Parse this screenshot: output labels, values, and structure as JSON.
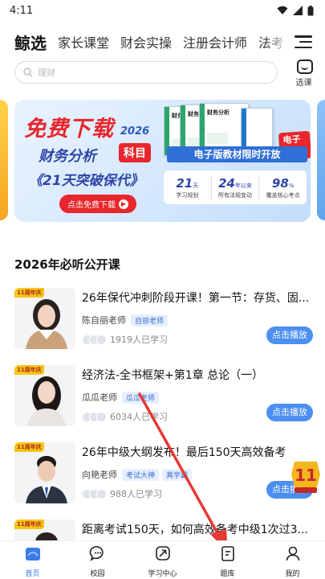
{
  "status": {
    "time": "4:11"
  },
  "top_tabs": [
    "鲸选",
    "家长课堂",
    "财会实操",
    "注册会计师",
    "法考"
  ],
  "search": {
    "placeholder": "理财"
  },
  "course_select_label": "选课",
  "banner": {
    "title": "免费下载",
    "year": "2026",
    "subject": "财务分析",
    "subject_badge": "科目",
    "subtitle": "《21天突破保代》",
    "cta": "点击免费下载",
    "book_label": "财务分析",
    "ebook_tag": "电子版",
    "ebook_line": "电子版教材限时开放",
    "stats": [
      {
        "num": "21",
        "unit": "天",
        "desc": "学习规划"
      },
      {
        "num": "24",
        "unit": "年以来",
        "desc": "所有法规变动"
      },
      {
        "num": "98",
        "unit": "%",
        "desc": "覆盖核心考点"
      }
    ]
  },
  "section_title": "2026年必听公开课",
  "courses": [
    {
      "ribbon": "11周年庆",
      "title": "26年保代冲刺阶段开课！第一节：存货、固...",
      "teacher": "陈自丽老师",
      "tags": [
        "自丽老师"
      ],
      "learners": "1919人已学习",
      "button": "点击播放"
    },
    {
      "ribbon": "11周年庆",
      "title": "经济法-全书框架+第1章 总论（一）",
      "teacher": "瓜瓜老师",
      "tags": [
        "瓜瓜老师"
      ],
      "learners": "6034人已学习",
      "button": "点击播放"
    },
    {
      "ribbon": "11周年庆",
      "title": "26年中级大纲发布！最后150天高效备考",
      "teacher": "向艳老师",
      "tags": [
        "考试大神",
        "真学霸"
      ],
      "learners": "988人已学习",
      "button": "点击播放"
    },
    {
      "ribbon": "11周年庆",
      "title": "距离考试150天，如何高效备考中级1次过3...",
      "teacher": "",
      "tags": [],
      "learners": "",
      "button": ""
    }
  ],
  "tabbar": [
    {
      "label": "首页",
      "icon": "home-icon"
    },
    {
      "label": "校园",
      "icon": "chat-icon"
    },
    {
      "label": "学习中心",
      "icon": "leaf-icon"
    },
    {
      "label": "题库",
      "icon": "question-bank-icon"
    },
    {
      "label": "我的",
      "icon": "profile-icon"
    }
  ],
  "colors": {
    "accent": "#3b7ce6",
    "play_button": "#4b8ff0",
    "promo_red": "#e8262b",
    "annotation_arrow": "#e53935"
  }
}
